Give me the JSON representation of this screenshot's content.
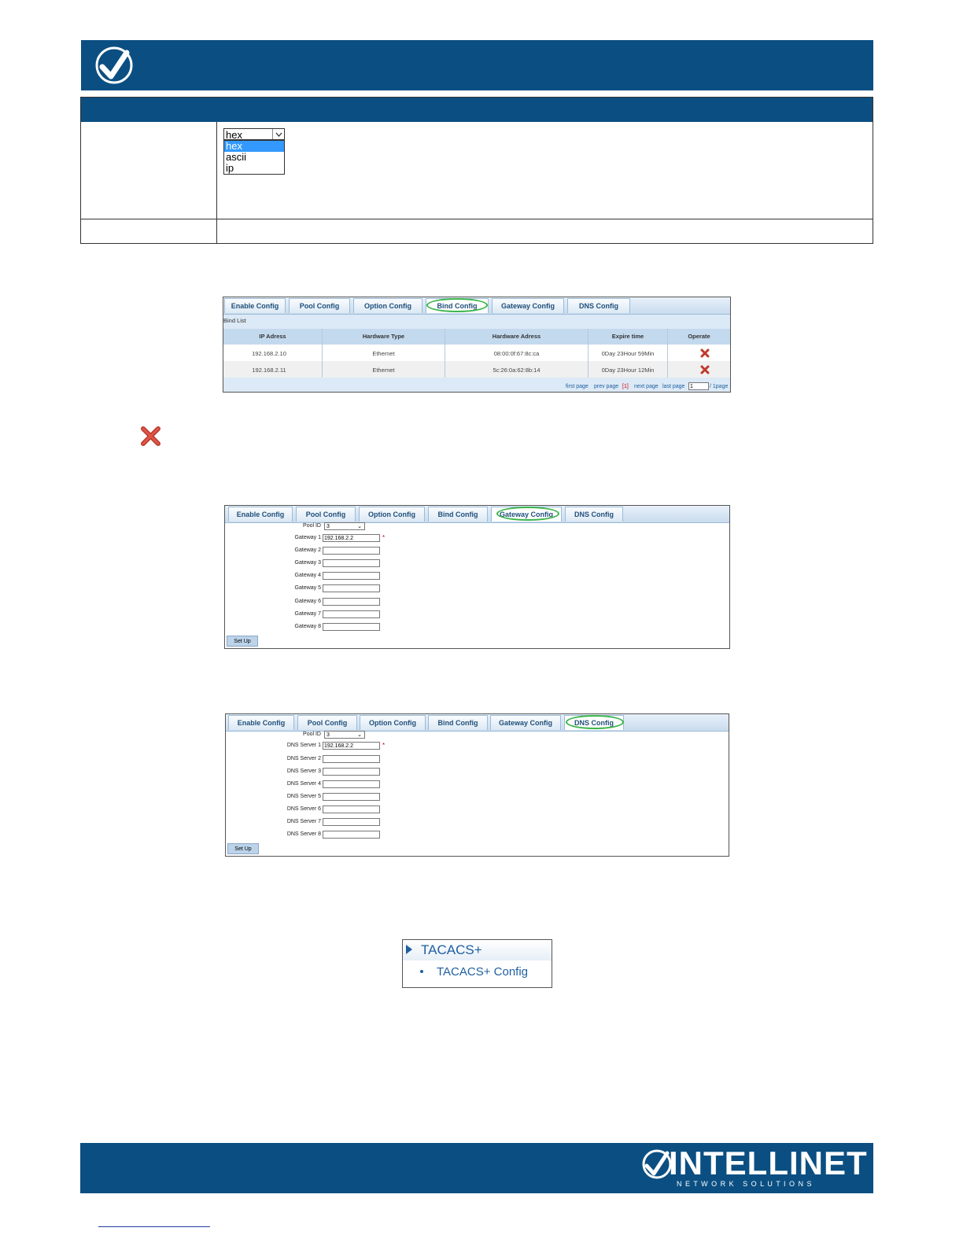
{
  "dropdown": {
    "selected": "hex",
    "options": [
      "hex",
      "ascii",
      "ip"
    ]
  },
  "tabs": [
    "Enable Config",
    "Pool Config",
    "Option Config",
    "Bind Config",
    "Gateway Config",
    "DNS Config"
  ],
  "bind": {
    "list_title": "Bind List",
    "headers": [
      "IP Adress",
      "Hardware Type",
      "Hardware Adress",
      "Expire time",
      "Operate"
    ],
    "rows": [
      [
        "192.168.2.10",
        "Ethernet",
        "08:00:0f:67:8c:ca",
        "0Day 23Hour 59Min"
      ],
      [
        "192.168.2.11",
        "Ethernet",
        "5c:26:0a:62:8b:14",
        "0Day 23Hour 12Min"
      ]
    ],
    "pager": {
      "first": "first page",
      "prev": "prev page",
      "current": "[1]",
      "next": "next page",
      "last": "last page",
      "page_value": "1",
      "total": "/ 1page"
    }
  },
  "gateway": {
    "pool_label": "Pool ID",
    "pool_value": "3",
    "labels": [
      "Gateway 1",
      "Gateway 2",
      "Gateway 3",
      "Gateway 4",
      "Gateway 5",
      "Gateway 6",
      "Gateway 7",
      "Gateway 8"
    ],
    "first_value": "192.168.2.2",
    "required_mark": "*",
    "button": "Set Up"
  },
  "dns": {
    "pool_label": "Pool ID",
    "pool_value": "3",
    "labels": [
      "DNS Server 1",
      "DNS Server 2",
      "DNS Server 3",
      "DNS Server 4",
      "DNS Server 5",
      "DNS Server 6",
      "DNS Server 7",
      "DNS Server 8"
    ],
    "first_value": "192.168.2.2",
    "required_mark": "*",
    "button": "Set Up"
  },
  "menu": {
    "section": "TACACS+",
    "item": "TACACS+ Config"
  },
  "footer": {
    "brand": "INTELLINET",
    "tagline": "N E T W O R K   S O L U T I O N S"
  },
  "colors": {
    "navy": "#0b4f82",
    "highlight": "#3cb54a",
    "delete": "#c0392b"
  }
}
